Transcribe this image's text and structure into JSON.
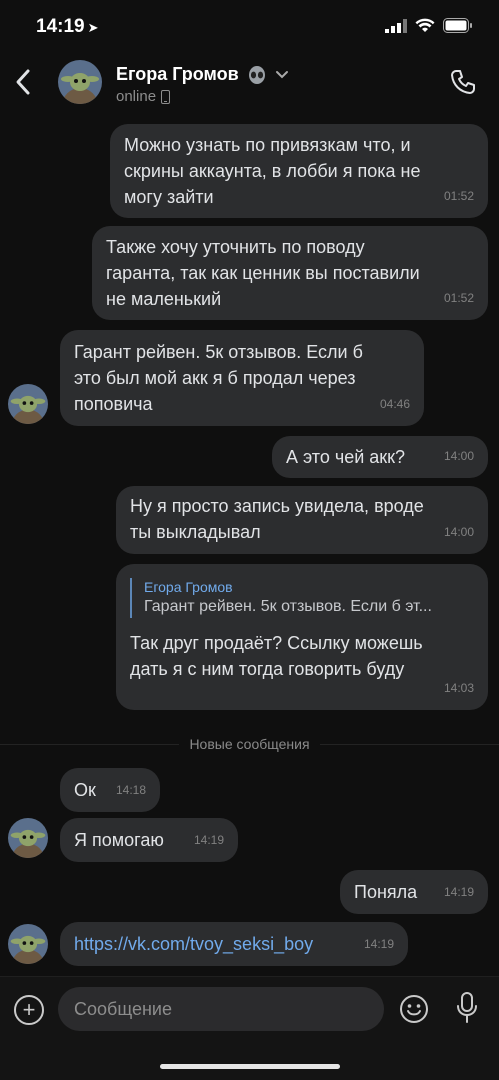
{
  "status": {
    "time": "14:19"
  },
  "header": {
    "name": "Егора Громов",
    "online": "online"
  },
  "messages": [
    {
      "text": "Можно узнать по привязкам что, и\nскрины аккаунта, в лобби я пока не\nмогу зайти",
      "time": "01:52"
    },
    {
      "text": "Также хочу уточнить по поводу\nгаранта, так как ценник вы поставили\nне маленький",
      "time": "01:52"
    },
    {
      "text": "Гарант рейвен. 5к отзывов. Если б\nэто был мой акк я б продал через\nпоповича",
      "time": "04:46"
    },
    {
      "text": "А это чей акк?",
      "time": "14:00"
    },
    {
      "text": "Ну я просто запись увидела, вроде\nты выкладывал",
      "time": "14:00"
    },
    {
      "reply_name": "Егора Громов",
      "reply_text": "Гарант рейвен. 5к отзывов. Если б эт...",
      "text": "Так друг продаёт? Ссылку можешь\nдать я с ним тогда говорить буду",
      "time": "14:03"
    },
    {
      "text": "Ок",
      "time": "14:18"
    },
    {
      "text": "Я помогаю",
      "time": "14:19"
    },
    {
      "text": "Поняла",
      "time": "14:19"
    },
    {
      "text": "https://vk.com/tvoy_seksi_boy",
      "time": "14:19"
    }
  ],
  "divider": "Новые сообщения",
  "composer": {
    "placeholder": "Сообщение"
  },
  "colors": {
    "bubble": "#2c2d2f",
    "link": "#71aaeb",
    "background": "#0f0f0f"
  }
}
